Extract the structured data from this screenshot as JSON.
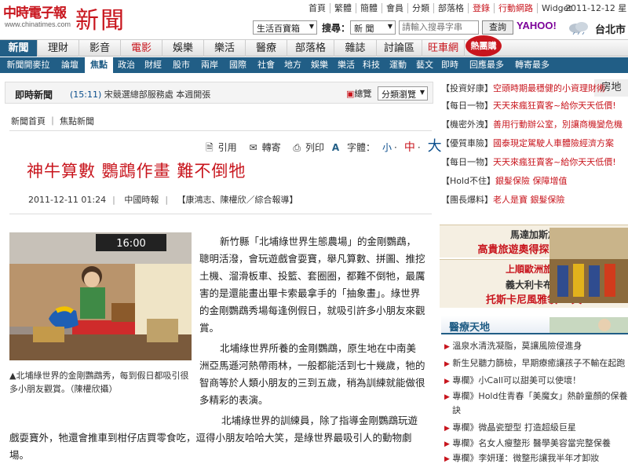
{
  "site": {
    "logo_name": "中時電子報",
    "logo_domain": "www.chinatimes.com",
    "section_title": "新聞"
  },
  "toplinks": [
    "首頁",
    "繁體",
    "簡體",
    "會員",
    "分類",
    "部落格",
    "登錄",
    "行動網路",
    "Widget"
  ],
  "date": "2011-12-12 星",
  "search": {
    "category": "生活百寶箱",
    "label": "搜尋：",
    "type": "新 聞",
    "placeholder": "請輸入搜尋字串",
    "button": "查詢"
  },
  "yahoo": "YAHOO!",
  "city": "台北市",
  "nav_main": [
    "新聞",
    "理財",
    "影音",
    "電影",
    "娛樂",
    "樂活",
    "醫療",
    "部落格",
    "雜誌",
    "討論區",
    "旺車網"
  ],
  "nav_hot_badge": "熱團購",
  "nav_right": "房地",
  "nav_sub": [
    "新聞開麥拉",
    "論壇",
    "焦點",
    "政治",
    "財經",
    "股市",
    "兩岸",
    "國際",
    "社會",
    "地方",
    "娛樂",
    "樂活",
    "科技",
    "運動",
    "藝文",
    "即時",
    "回應最多",
    "轉寄最多"
  ],
  "ticker": {
    "label": "即時新聞",
    "time": "(15:11)",
    "text": "宋競選總部服務處 本週開張",
    "archive": "總覽",
    "classify": "分類瀏覽"
  },
  "breadcrumb": "新聞首頁 ｜ 焦點新聞",
  "tools": {
    "cite": "引用",
    "forward": "轉寄",
    "print": "列印",
    "fontsize": "字體：",
    "small": "小",
    "medium": "中",
    "large": "大"
  },
  "article": {
    "title": "神牛算數 鸚鵡作畫 難不倒牠",
    "datetime": "2011-12-11 01:24",
    "source": "中國時報",
    "authors": "【康鴻志、陳權欣／綜合報導】",
    "photo_clock": "16:00",
    "caption": "▲北埔綠世界的金剛鸚鵡秀，每到假日都吸引很多小朋友觀賞。（陳權欣攝）",
    "p1": "新竹縣「北埔綠世界生態農場」的金剛鸚鵡，聰明活潑，會玩遊戲會耍寶，舉凡算數、拼圖、推挖土機、溜滑板車、投籃、套圈圈，都難不倒牠，最厲害的是還能畫出畢卡索最拿手的「抽象畫」。綠世界的金剛鸚鵡秀場每逢例假日，就吸引許多小朋友來觀賞。",
    "p2": "北埔綠世界所養的金剛鸚鵡，原生地在中南美洲亞馬遜河熱帶雨林，一般都能活到七十幾歲，牠的智商等於人類小朋友的三到五歲，稍為訓練就能做很多精彩的表演。",
    "p3": "北埔綠世界的訓練員，除了指導金剛鸚鵡玩遊戲耍寶外，牠還會推車到柑仔店買零食吃，逗得小朋友哈哈大笑，是綠世界最吸引人的動物劇場。"
  },
  "promos": [
    {
      "tag": "【投資好康】",
      "text": "空頭時期最穩健的小資理財術"
    },
    {
      "tag": "【每日一物】",
      "text": "天天來瘋狂賣客~給你天天低價!"
    },
    {
      "tag": "【機密外洩】",
      "text": "善用行動辦公室，別讓商機變危機"
    },
    {
      "tag": "【優質車險】",
      "text": "國泰現定駕駛人車體險經濟方案"
    },
    {
      "tag": "【每日一物】",
      "text": "天天來瘋狂賣客~給你天天低價!"
    },
    {
      "tag": "【Hold不住】",
      "text": "銀髮保險 保障增值"
    },
    {
      "tag": "【團長爆料】",
      "text": "老人是寶 銀髮保險"
    }
  ],
  "ad1": {
    "line1": "馬達加斯加",
    "line2": "高貴旅遊奧得探索奇之旅"
  },
  "ad2": {
    "line1": "上順歐洲旅遊",
    "line2": "義大利卡布里",
    "line3": "托斯卡尼風雅領10天"
  },
  "medical": {
    "title": "醫療天地",
    "items": [
      {
        "badge": "▶",
        "text": "溫泉水清洗凝脂，莫讓風險侵進身"
      },
      {
        "badge": "▶",
        "text": "新生兒聽力篩檢，早期療癒讓孩子不輸在起跑"
      },
      {
        "badge": "▶",
        "text": "專欄》小Call可以甜美可以使壞！"
      },
      {
        "badge": "▶",
        "text": "專欄》Hold住青春「美魔女」熱齡童顏的保養"
      },
      {
        "badge": "",
        "text": "訣"
      },
      {
        "badge": "▶",
        "text": "專欄》微晶瓷塑型 打造超級巨星"
      },
      {
        "badge": "▶",
        "text": "專欄》名女人瘦整形 醫學美容當完整保養"
      },
      {
        "badge": "▶",
        "text": "專欄》李妍瑾：微整形讓我半年才卸妝"
      }
    ]
  },
  "colors": {
    "brand_red": "#c8151d",
    "nav_blue": "#215e86",
    "link_blue": "#0a4d8c"
  }
}
